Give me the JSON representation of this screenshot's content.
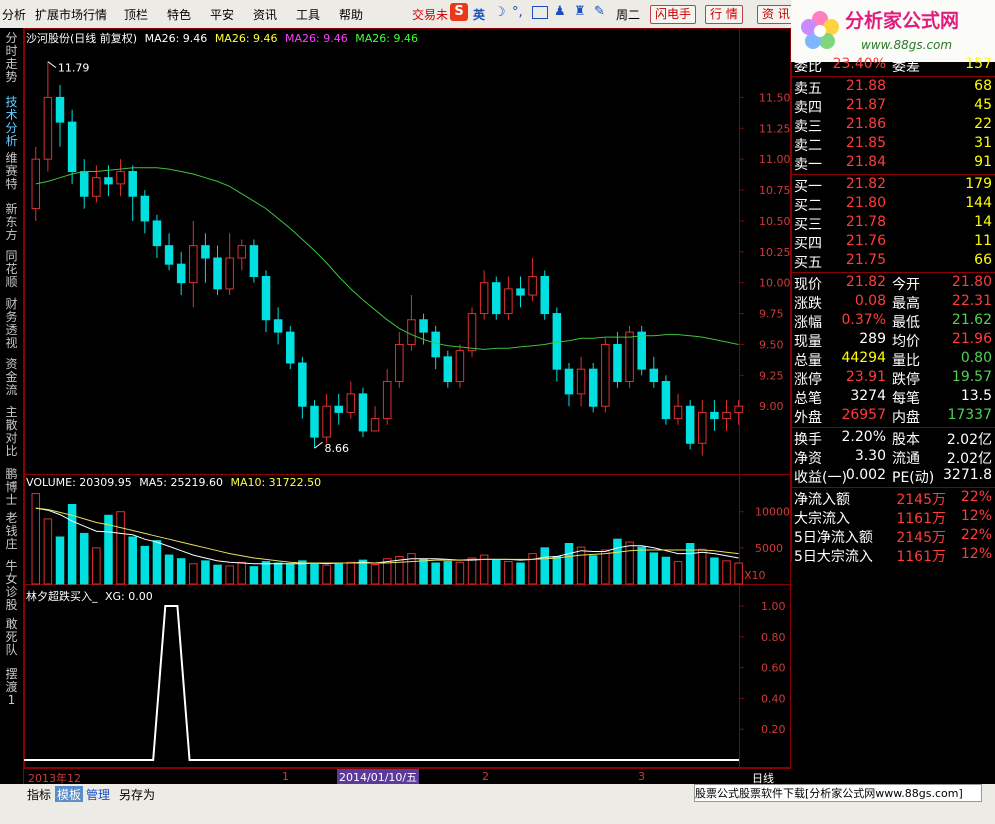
{
  "menu": [
    "分析",
    "扩展市场行情",
    "顶栏",
    "特色",
    "平安",
    "资讯",
    "工具",
    "帮助"
  ],
  "toolbar": {
    "trade": "交易未",
    "ime": "英",
    "flash": "闪电手",
    "quote": "行 情",
    "info": "资 讯",
    "week": "周二"
  },
  "logo": {
    "brand": "分析家公式网",
    "url": "www.88gs.com"
  },
  "left_tabs": [
    "分时走势",
    "技术分析",
    "维赛特",
    "新东方",
    "同花顺",
    "财务透视",
    "资金流",
    "主散对比",
    "鹏博士",
    "老钱庄",
    "牛女诊股",
    "敢死队",
    "摆渡1"
  ],
  "active_tab": 1,
  "kline_title": {
    "name": "沙河股份(日线 前复权)",
    "ma1": "MA26: 9.46",
    "ma2": "MA26: 9.46",
    "ma3": "MA26: 9.46",
    "ma4": "MA26: 9.46"
  },
  "kline_max_label": "11.79",
  "kline_min_label": "8.66",
  "price_axis": [
    "11.50",
    "11.25",
    "11.00",
    "10.75",
    "10.50",
    "10.25",
    "10.00",
    "9.75",
    "9.50",
    "9.25",
    "9.00"
  ],
  "volume_title": {
    "vol": "VOLUME: 20309.95",
    "ma5": "MA5: 25219.60",
    "ma10": "MA10: 31722.50"
  },
  "volume_axis": [
    "10000",
    "5000"
  ],
  "volume_unit": "X10",
  "indicator_title": {
    "name": "林夕超跌买入_",
    "xg": "XG: 0.00"
  },
  "indicator_axis": [
    "1.00",
    "0.80",
    "0.60",
    "0.40",
    "0.20"
  ],
  "dates": {
    "d1": "2013年12",
    "d2": "1",
    "d3": "2014/01/10/五",
    "d4": "2",
    "d5": "3",
    "period": "日线"
  },
  "quote": {
    "weibi": {
      "label": "委比",
      "value": "23.40%",
      "label2": "委差",
      "value2": "157"
    },
    "sells": [
      {
        "label": "卖五",
        "price": "21.88",
        "vol": "68"
      },
      {
        "label": "卖四",
        "price": "21.87",
        "vol": "45"
      },
      {
        "label": "卖三",
        "price": "21.86",
        "vol": "22"
      },
      {
        "label": "卖二",
        "price": "21.85",
        "vol": "31"
      },
      {
        "label": "卖一",
        "price": "21.84",
        "vol": "91"
      }
    ],
    "buys": [
      {
        "label": "买一",
        "price": "21.82",
        "vol": "179"
      },
      {
        "label": "买二",
        "price": "21.80",
        "vol": "144"
      },
      {
        "label": "买三",
        "price": "21.78",
        "vol": "14"
      },
      {
        "label": "买四",
        "price": "21.76",
        "vol": "11"
      },
      {
        "label": "买五",
        "price": "21.75",
        "vol": "66"
      }
    ],
    "stats": [
      {
        "l1": "现价",
        "v1": "21.82",
        "l2": "今开",
        "v2": "21.80",
        "c1": "#ff3c3c",
        "c2": "#ff3c3c"
      },
      {
        "l1": "涨跌",
        "v1": "0.08",
        "l2": "最高",
        "v2": "22.31",
        "c1": "#ff3c3c",
        "c2": "#ff3c3c"
      },
      {
        "l1": "涨幅",
        "v1": "0.37%",
        "l2": "最低",
        "v2": "21.62",
        "c1": "#ff3c3c",
        "c2": "#4fd34f"
      },
      {
        "l1": "现量",
        "v1": "289",
        "l2": "均价",
        "v2": "21.96",
        "c1": "#ffffff",
        "c2": "#ff3c3c"
      },
      {
        "l1": "总量",
        "v1": "44294",
        "l2": "量比",
        "v2": "0.80",
        "c1": "#ffff00",
        "c2": "#4fd34f"
      },
      {
        "l1": "涨停",
        "v1": "23.91",
        "l2": "跌停",
        "v2": "19.57",
        "c1": "#ff3c3c",
        "c2": "#4fd34f"
      },
      {
        "l1": "总笔",
        "v1": "3274",
        "l2": "每笔",
        "v2": "13.5",
        "c1": "#ffffff",
        "c2": "#ffffff"
      },
      {
        "l1": "外盘",
        "v1": "26957",
        "l2": "内盘",
        "v2": "17337",
        "c1": "#ff3c3c",
        "c2": "#4fd34f"
      }
    ],
    "stats2": [
      {
        "l1": "换手",
        "v1": "2.20%",
        "l2": "股本",
        "v2": "2.02亿"
      },
      {
        "l1": "净资",
        "v1": "3.30",
        "l2": "流通",
        "v2": "2.02亿"
      },
      {
        "l1": "收益(一)",
        "v1": "0.002",
        "l2": "PE(动)",
        "v2": "3271.8"
      }
    ],
    "flows": [
      {
        "label": "净流入额",
        "value": "2145",
        "unit": "万",
        "pct": "22%"
      },
      {
        "label": "大宗流入",
        "value": "1161",
        "unit": "万",
        "pct": "12%"
      },
      {
        "label": "5日净流入额",
        "value": "2145",
        "unit": "万",
        "pct": "22%"
      },
      {
        "label": "5日大宗流入",
        "value": "1161",
        "unit": "万",
        "pct": "12%"
      }
    ]
  },
  "bottom_tabs": [
    "指标",
    "模板",
    "管理",
    "另存为"
  ],
  "promo": "股票公式股票软件下载[分析家公式网www.88gs.com]",
  "colors": {
    "up": "#e03030",
    "down": "#00e0e0",
    "ma": "#3cc43c",
    "vol_ma5": "#ffffff",
    "vol_ma10": "#e8e060",
    "grid": "#8b0000"
  },
  "chart_data": {
    "type": "candlestick",
    "price_min": 8.5,
    "price_max": 11.9,
    "ma26": [
      10.8,
      10.82,
      10.85,
      10.88,
      10.9,
      10.9,
      10.91,
      10.92,
      10.93,
      10.93,
      10.93,
      10.92,
      10.9,
      10.88,
      10.85,
      10.82,
      10.78,
      10.72,
      10.66,
      10.6,
      10.52,
      10.44,
      10.35,
      10.26,
      10.16,
      10.05,
      9.95,
      9.86,
      9.78,
      9.7,
      9.63,
      9.58,
      9.54,
      9.51,
      9.49,
      9.48,
      9.47,
      9.46,
      9.47,
      9.47,
      9.48,
      9.49,
      9.5,
      9.52,
      9.53,
      9.55,
      9.55,
      9.56,
      9.56,
      9.56,
      9.57,
      9.57,
      9.58,
      9.58,
      9.57,
      9.56,
      9.54,
      9.52,
      9.5
    ],
    "candles": [
      [
        10.6,
        11.0,
        11.1,
        10.5
      ],
      [
        11.0,
        11.5,
        11.79,
        10.9
      ],
      [
        11.5,
        11.3,
        11.6,
        11.1
      ],
      [
        11.3,
        10.9,
        11.4,
        10.8
      ],
      [
        10.9,
        10.7,
        11.0,
        10.6
      ],
      [
        10.7,
        10.85,
        10.95,
        10.65
      ],
      [
        10.85,
        10.8,
        10.95,
        10.7
      ],
      [
        10.8,
        10.9,
        11.0,
        10.7
      ],
      [
        10.9,
        10.7,
        10.95,
        10.5
      ],
      [
        10.7,
        10.5,
        10.75,
        10.4
      ],
      [
        10.5,
        10.3,
        10.55,
        10.2
      ],
      [
        10.3,
        10.15,
        10.4,
        10.1
      ],
      [
        10.15,
        10.0,
        10.25,
        9.9
      ],
      [
        10.0,
        10.3,
        10.5,
        9.8
      ],
      [
        10.3,
        10.2,
        10.4,
        10.0
      ],
      [
        10.2,
        9.95,
        10.3,
        9.9
      ],
      [
        9.95,
        10.2,
        10.4,
        9.9
      ],
      [
        10.2,
        10.3,
        10.35,
        10.1
      ],
      [
        10.3,
        10.05,
        10.35,
        10.0
      ],
      [
        10.05,
        9.7,
        10.1,
        9.6
      ],
      [
        9.7,
        9.6,
        9.8,
        9.5
      ],
      [
        9.6,
        9.35,
        9.65,
        9.3
      ],
      [
        9.35,
        9.0,
        9.4,
        8.9
      ],
      [
        9.0,
        8.75,
        9.05,
        8.66
      ],
      [
        8.75,
        9.0,
        9.1,
        8.7
      ],
      [
        9.0,
        8.95,
        9.1,
        8.85
      ],
      [
        8.95,
        9.1,
        9.2,
        8.9
      ],
      [
        9.1,
        8.8,
        9.15,
        8.75
      ],
      [
        8.8,
        8.9,
        9.0,
        8.8
      ],
      [
        8.9,
        9.2,
        9.3,
        8.85
      ],
      [
        9.2,
        9.5,
        9.6,
        9.15
      ],
      [
        9.5,
        9.7,
        9.9,
        9.45
      ],
      [
        9.7,
        9.6,
        9.75,
        9.5
      ],
      [
        9.6,
        9.4,
        9.65,
        9.3
      ],
      [
        9.4,
        9.2,
        9.45,
        9.15
      ],
      [
        9.2,
        9.45,
        9.5,
        9.15
      ],
      [
        9.45,
        9.75,
        9.8,
        9.4
      ],
      [
        9.75,
        10.0,
        10.1,
        9.7
      ],
      [
        10.0,
        9.75,
        10.05,
        9.7
      ],
      [
        9.75,
        9.95,
        10.05,
        9.7
      ],
      [
        9.95,
        9.9,
        10.05,
        9.8
      ],
      [
        9.9,
        10.05,
        10.2,
        9.85
      ],
      [
        10.05,
        9.75,
        10.1,
        9.7
      ],
      [
        9.75,
        9.3,
        9.8,
        9.2
      ],
      [
        9.3,
        9.1,
        9.35,
        9.0
      ],
      [
        9.1,
        9.3,
        9.4,
        9.0
      ],
      [
        9.3,
        9.0,
        9.35,
        8.95
      ],
      [
        9.0,
        9.5,
        9.55,
        8.95
      ],
      [
        9.5,
        9.2,
        9.6,
        9.15
      ],
      [
        9.2,
        9.6,
        9.65,
        9.15
      ],
      [
        9.6,
        9.3,
        9.65,
        9.25
      ],
      [
        9.3,
        9.2,
        9.4,
        9.15
      ],
      [
        9.2,
        8.9,
        9.25,
        8.85
      ],
      [
        8.9,
        9.0,
        9.1,
        8.85
      ],
      [
        9.0,
        8.7,
        9.05,
        8.65
      ],
      [
        8.7,
        8.95,
        9.05,
        8.6
      ],
      [
        8.95,
        8.9,
        9.05,
        8.8
      ],
      [
        8.9,
        8.95,
        9.05,
        8.8
      ],
      [
        8.95,
        9.0,
        9.05,
        8.85
      ]
    ],
    "volume_max": 13000,
    "volumes": [
      12500,
      9000,
      6500,
      11000,
      7000,
      5000,
      9500,
      10000,
      6500,
      5200,
      6000,
      4000,
      3500,
      2800,
      3200,
      2600,
      2500,
      3000,
      2400,
      3100,
      2900,
      2700,
      3200,
      2800,
      2600,
      2900,
      3000,
      3300,
      2700,
      3500,
      3800,
      4200,
      3400,
      2900,
      3100,
      3000,
      3600,
      4000,
      3300,
      3100,
      2900,
      4200,
      5000,
      3800,
      5600,
      5100,
      3900,
      4700,
      6200,
      5800,
      5100,
      4300,
      3700,
      3100,
      5600,
      4800,
      3600,
      3200,
      2900
    ],
    "vol_ma5": [
      10500,
      10200,
      9600,
      8700,
      8000,
      7300,
      7200,
      7000,
      6800,
      6200,
      5800,
      5200,
      4600,
      4000,
      3600,
      3200,
      3000,
      2900,
      2800,
      2800,
      2800,
      2800,
      2800,
      2900,
      2800,
      2900,
      2900,
      3000,
      2900,
      3100,
      3300,
      3500,
      3500,
      3500,
      3400,
      3300,
      3300,
      3400,
      3400,
      3400,
      3300,
      3400,
      3700,
      3800,
      4200,
      4600,
      4500,
      4500,
      5000,
      5300,
      5300,
      5000,
      4600,
      4200,
      4200,
      4400,
      4200,
      3900,
      3600
    ],
    "vol_ma10": [
      10500,
      10300,
      9900,
      9500,
      9000,
      8500,
      8200,
      7800,
      7400,
      7000,
      6600,
      6200,
      5800,
      5400,
      5000,
      4600,
      4200,
      3900,
      3600,
      3400,
      3200,
      3000,
      2900,
      2900,
      2900,
      2900,
      2900,
      2900,
      2900,
      2900,
      3000,
      3100,
      3200,
      3300,
      3300,
      3300,
      3400,
      3400,
      3400,
      3400,
      3400,
      3400,
      3500,
      3600,
      3800,
      4000,
      4100,
      4200,
      4400,
      4600,
      4700,
      4700,
      4700,
      4700,
      4700,
      4700,
      4600,
      4400,
      4200
    ],
    "xg_signal_index": 11
  }
}
